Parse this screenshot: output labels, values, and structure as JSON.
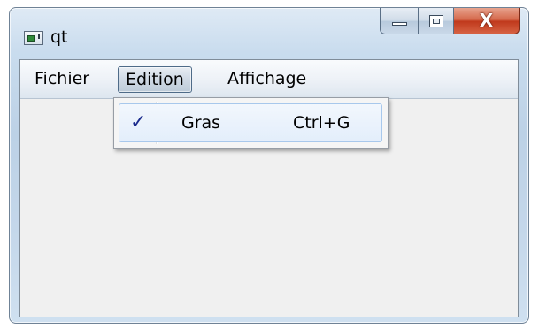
{
  "window": {
    "title": "qt",
    "icon": "qt-app-icon",
    "caption_buttons": {
      "minimize_icon": "minimize-icon",
      "maximize_icon": "maximize-icon",
      "close_glyph": "X"
    }
  },
  "menubar": {
    "items": [
      {
        "label": "Fichier"
      },
      {
        "label": "Edition",
        "state": "open"
      },
      {
        "label": "Affichage"
      }
    ]
  },
  "dropdown": {
    "items": [
      {
        "label": "Gras",
        "shortcut": "Ctrl+G",
        "checked": true,
        "check_glyph": "✓"
      }
    ]
  },
  "colors": {
    "close_button": "#c0391c",
    "checkmark": "#1a2a8c",
    "highlight_border": "#a8c8ec"
  }
}
